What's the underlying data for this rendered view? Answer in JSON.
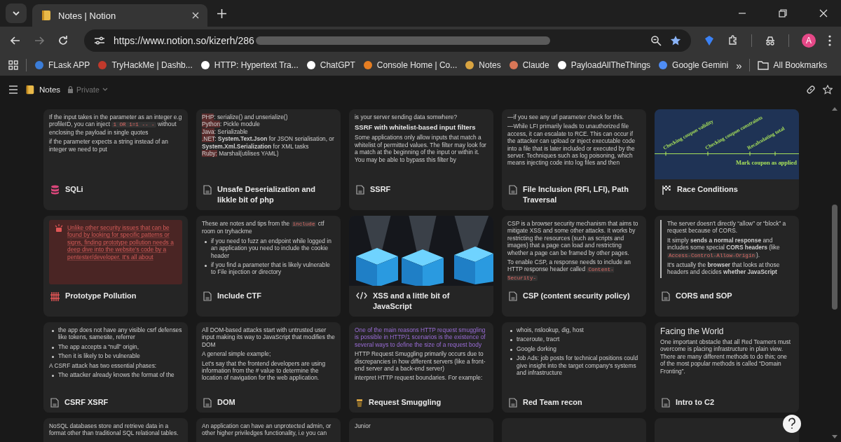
{
  "browser": {
    "tab": {
      "title": "Notes | Notion"
    },
    "url": "https://www.notion.so/kizerh/286",
    "avatar": "A",
    "bookmarks": [
      {
        "label": "FLask APP"
      },
      {
        "label": "TryHackMe | Dashb..."
      },
      {
        "label": "HTTP: Hypertext Tra..."
      },
      {
        "label": "ChatGPT"
      },
      {
        "label": "Console Home | Co..."
      },
      {
        "label": "Notes"
      },
      {
        "label": "Claude"
      },
      {
        "label": "PayloadAllTheThings"
      },
      {
        "label": "Google Gemini"
      }
    ],
    "more": "»",
    "all_bookmarks": "All Bookmarks"
  },
  "page": {
    "title": "Notes",
    "visibility": "Private"
  },
  "cards": [
    {
      "title": "SQLi",
      "preview": {
        "kind": "blocks",
        "blocks": [
          {
            "kind": "p",
            "runs": [
              "If the input takes in the parameter as an integer e.g profileID, you can inject ",
              {
                "code": "1 OR 1=1 -- -"
              },
              " without enclosing the payload in single quotes"
            ]
          },
          {
            "kind": "p",
            "runs": [
              "if the parameter expects a string instead of an integer we need to put"
            ]
          }
        ]
      }
    },
    {
      "title": "Unsafe Deserialization and likkle bit of php",
      "preview": {
        "kind": "blocks",
        "blocks": [
          {
            "kind": "line",
            "runs": [
              {
                "mark": "PHP"
              },
              ": serialize() and unserialize()"
            ]
          },
          {
            "kind": "line",
            "runs": [
              {
                "mark": "Python"
              },
              ": Pickle module"
            ]
          },
          {
            "kind": "line",
            "runs": [
              {
                "mark": "Java"
              },
              ": Serializable"
            ]
          },
          {
            "kind": "line",
            "runs": [
              {
                "mark": ".NET"
              },
              ": **System.Text.Json** for JSON serialisation, or **System.Xml.Serialization** for XML tasks"
            ]
          },
          {
            "kind": "line",
            "runs": [
              {
                "mark": "Ruby:"
              },
              " Marshal(utilises YAML)"
            ]
          }
        ]
      }
    },
    {
      "title": "SSRF",
      "preview": {
        "kind": "blocks",
        "blocks": [
          {
            "kind": "p",
            "runs": [
              "is your server sending data somwhere?"
            ]
          },
          {
            "kind": "h",
            "runs": [
              "SSRF with whitelist-based input filters"
            ]
          },
          {
            "kind": "p",
            "runs": [
              "Some applications only allow inputs that match a whitelist of permitted values. The filter may look for a match at the beginning of the input or within it. You may be able to bypass this filter by"
            ]
          }
        ]
      }
    },
    {
      "title": "File Inclusion (RFI, LFI), Path Traversal",
      "preview": {
        "kind": "blocks",
        "blocks": [
          {
            "kind": "p",
            "runs": [
              "—if you see any url parameter check for this."
            ]
          },
          {
            "kind": "p",
            "runs": [
              "—While LFI primarily leads to unauthorized file access, it can escalate to RCE. This can occur if the attacker can upload or inject executable code into a file that is later included or executed by the server. Techniques such as log poisoning, which means injecting code into log files and then"
            ]
          }
        ]
      }
    },
    {
      "title": "Race Conditions",
      "preview": {
        "kind": "diagram",
        "labels": [
          "Checking coupon validity",
          "Checking coupon constraints",
          "Recalculating total",
          "Mark coupon as applied"
        ]
      }
    },
    {
      "title": "Prototype Pollution",
      "preview": {
        "kind": "blocks",
        "blocks": [
          {
            "kind": "callout",
            "runs": [
              "Unlike other security issues that can be found by looking for specific patterns or signs, finding prototype pollution needs a deep dive into the website's code by a pentester/developer. It's all about"
            ]
          }
        ]
      }
    },
    {
      "title": "Include CTF",
      "preview": {
        "kind": "blocks",
        "blocks": [
          {
            "kind": "p",
            "runs": [
              "These are notes and tips from the ",
              {
                "code": "include"
              },
              " ctf room on tryhackme"
            ]
          },
          {
            "kind": "bullet",
            "runs": [
              "if you need to fuzz an endpoint while logged in an application you need to include the cookie header"
            ]
          },
          {
            "kind": "bullet",
            "runs": [
              "if you find a parameter that is likely vulnerable to File injection or directory"
            ]
          }
        ]
      }
    },
    {
      "title": "XSS and a little bit of JavaScript"
    },
    {
      "title": "CSP (content security policy)",
      "preview": {
        "kind": "blocks",
        "blocks": [
          {
            "kind": "p",
            "runs": [
              "CSP is a browser security mechanism that aims to mitigate XSS and some other attacks. It works by restricting the resources (such as scripts and images) that a page can load and restricting whether a page can be framed by other pages."
            ]
          },
          {
            "kind": "p",
            "runs": [
              "To enable CSP, a response needs to include an HTTP response header called ",
              {
                "code": "Content-Security-"
              }
            ]
          }
        ]
      }
    },
    {
      "title": "CORS and SOP",
      "preview": {
        "kind": "blocks",
        "blocks": [
          {
            "kind": "quote",
            "runs": [
              "The server doesn't directly “allow” or “block” a request because of CORS."
            ]
          },
          {
            "kind": "quote",
            "runs": [
              "It simply **sends a normal response** and includes some special **CORS headers** (like ",
              {
                "code": "Access-Control-Allow-Origin"
              },
              ")."
            ]
          },
          {
            "kind": "quote",
            "runs": [
              "It's actually the **browser** that looks at those headers and decides **whether JavaScript**"
            ]
          }
        ]
      }
    },
    {
      "title": "CSRF XSRF",
      "preview": {
        "kind": "blocks",
        "blocks": [
          {
            "kind": "bullet",
            "runs": [
              "the app does not have any visible csrf defenses like tokens, samesite, referrer"
            ]
          },
          {
            "kind": "bullet",
            "runs": [
              "The app accepts a “null” origin,"
            ]
          },
          {
            "kind": "bullet",
            "runs": [
              "Then it is likely to be vulnerable"
            ]
          },
          {
            "kind": "p",
            "runs": [
              "A CSRF attack has two essential phases:"
            ]
          },
          {
            "kind": "bullet",
            "runs": [
              "The attacker already knows the format of the"
            ]
          }
        ]
      }
    },
    {
      "title": "DOM",
      "preview": {
        "kind": "blocks",
        "blocks": [
          {
            "kind": "p",
            "runs": [
              "All DOM-based attacks start with untrusted user input making its way to JavaScript that modifies the DOM"
            ]
          },
          {
            "kind": "p",
            "runs": [
              "A general simple example;"
            ]
          },
          {
            "kind": "p",
            "runs": [
              "Let's say that the frontend developers are using information from the # value to determine the location of navigation for the web application."
            ]
          }
        ]
      }
    },
    {
      "title": "Request Smuggling",
      "preview": {
        "kind": "blocks",
        "blocks": [
          {
            "kind": "accent",
            "runs": [
              "One of the main reasons HTTP request smuggling is possible in HTTP/1 scenarios is the existence of several ways to define the size of a request body"
            ]
          },
          {
            "kind": "p",
            "runs": [
              "HTTP Request Smuggling primarily occurs due to discrepancies in how different servers (like a front-end server and a back-end server)"
            ]
          },
          {
            "kind": "p",
            "runs": [
              "interpret HTTP request boundaries. For example:"
            ]
          }
        ]
      }
    },
    {
      "title": "Red Team recon",
      "preview": {
        "kind": "blocks",
        "blocks": [
          {
            "kind": "bullet",
            "runs": [
              "whois, nslookup, dig, host"
            ]
          },
          {
            "kind": "bullet",
            "runs": [
              "traceroute, tracrt"
            ]
          },
          {
            "kind": "bullet",
            "runs": [
              "Google dorking"
            ]
          },
          {
            "kind": "bullet",
            "runs": [
              "Job Ads:  job posts for technical positions could give insight into the target company's systems and infrastructure"
            ]
          }
        ]
      }
    },
    {
      "title": "Intro to C2",
      "preview": {
        "kind": "blocks",
        "blocks": [
          {
            "kind": "h2",
            "runs": [
              "Facing the World"
            ]
          },
          {
            "kind": "p",
            "runs": [
              "One important obstacle that all Red Teamers must overcome is placing infrastructure in plain view. There are many different methods to do this; one of the most popular methods is called “Domain Fronting”."
            ]
          }
        ]
      }
    },
    {
      "preview": {
        "kind": "blocks",
        "blocks": [
          {
            "kind": "p",
            "runs": [
              "NoSQL databases store and retrieve data in a format other than traditional SQL relational tables."
            ]
          }
        ]
      }
    },
    {
      "preview": {
        "kind": "blocks",
        "blocks": [
          {
            "kind": "p",
            "runs": [
              "An application can have an unprotected admin, or other higher priviledges functionality, i.e you can"
            ]
          }
        ]
      }
    },
    {
      "preview": {
        "kind": "blocks",
        "blocks": [
          {
            "kind": "p",
            "runs": [
              "Junior"
            ]
          }
        ]
      }
    }
  ]
}
